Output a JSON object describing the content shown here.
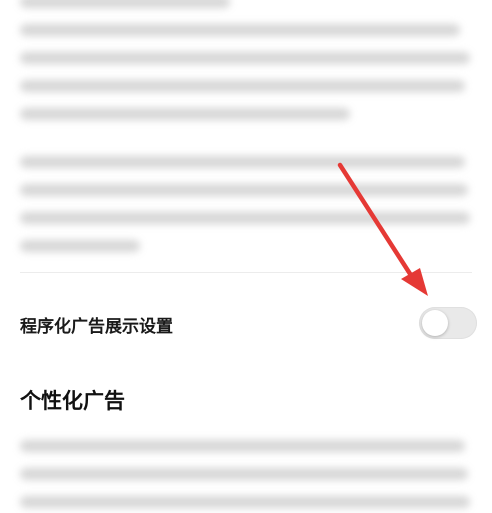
{
  "setting": {
    "label": "程序化广告展示设置",
    "toggle_state": "off"
  },
  "section": {
    "heading": "个性化广告"
  },
  "annotation": {
    "arrow_color": "#e53935"
  }
}
